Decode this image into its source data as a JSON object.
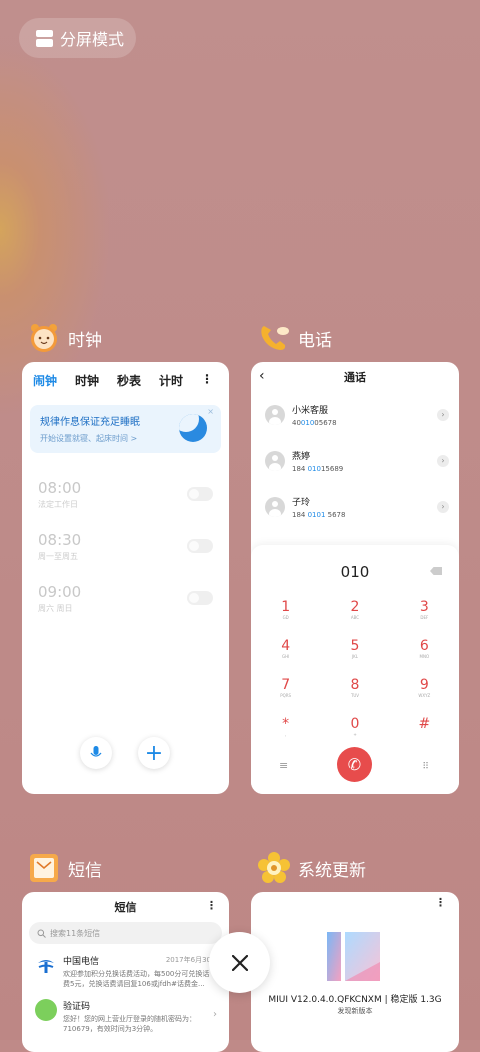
{
  "split_mode": {
    "label": "分屏模式"
  },
  "apps": {
    "clock": {
      "name": "时钟",
      "tabs": [
        "闹钟",
        "时钟",
        "秒表",
        "计时"
      ],
      "active_tab": "闹钟",
      "banner": {
        "title": "规律作息保证充足睡眠",
        "subtitle": "开始设置就寝、起床时间 >"
      },
      "alarms": [
        {
          "time": "08:00",
          "label": "法定工作日",
          "enabled": false
        },
        {
          "time": "08:30",
          "label": "周一至周五",
          "enabled": false
        },
        {
          "time": "09:00",
          "label": "周六 周日",
          "enabled": false
        }
      ]
    },
    "phone": {
      "name": "电话",
      "title": "通话",
      "contacts": [
        {
          "name": "小米客服",
          "num_a": "40",
          "num_hl": "010",
          "num_b": "05678"
        },
        {
          "name": "燕婷",
          "num_a": "184 ",
          "num_hl": "010",
          "num_b": "15689"
        },
        {
          "name": "子玲",
          "num_a": "184 ",
          "num_hl": "0101",
          "num_b": " 5678"
        }
      ],
      "dialed": "010",
      "keys": [
        {
          "d": "1",
          "l": "GD"
        },
        {
          "d": "2",
          "l": "ABC"
        },
        {
          "d": "3",
          "l": "DEF"
        },
        {
          "d": "4",
          "l": "GHI"
        },
        {
          "d": "5",
          "l": "JKL"
        },
        {
          "d": "6",
          "l": "MNO"
        },
        {
          "d": "7",
          "l": "PQRS"
        },
        {
          "d": "8",
          "l": "TUV"
        },
        {
          "d": "9",
          "l": "WXYZ"
        },
        {
          "d": "*",
          "l": ","
        },
        {
          "d": "0",
          "l": "+"
        },
        {
          "d": "#",
          "l": ""
        }
      ]
    },
    "sms": {
      "name": "短信",
      "title": "短信",
      "search_placeholder": "搜索11条短信",
      "messages": [
        {
          "sender": "中国电信",
          "date": "2017年6月30",
          "text": "欢迎参加积分兑换话费活动，每500分可兑换话费5元，兑换话费请回复106或jfdh#话费金..."
        },
        {
          "sender": "验证码",
          "date": "",
          "text": "您好！您的网上营业厅登录的随机密码为：710679，有效时间为3分钟。"
        }
      ]
    },
    "updater": {
      "name": "系统更新",
      "version": "MIUI V12.0.4.0.QFKCNXM | 稳定版 1.3G",
      "status": "发现新版本"
    }
  },
  "colors": {
    "accent": "#1e8ae6",
    "call": "#e74c4c",
    "dial_digits": "#e04848"
  }
}
